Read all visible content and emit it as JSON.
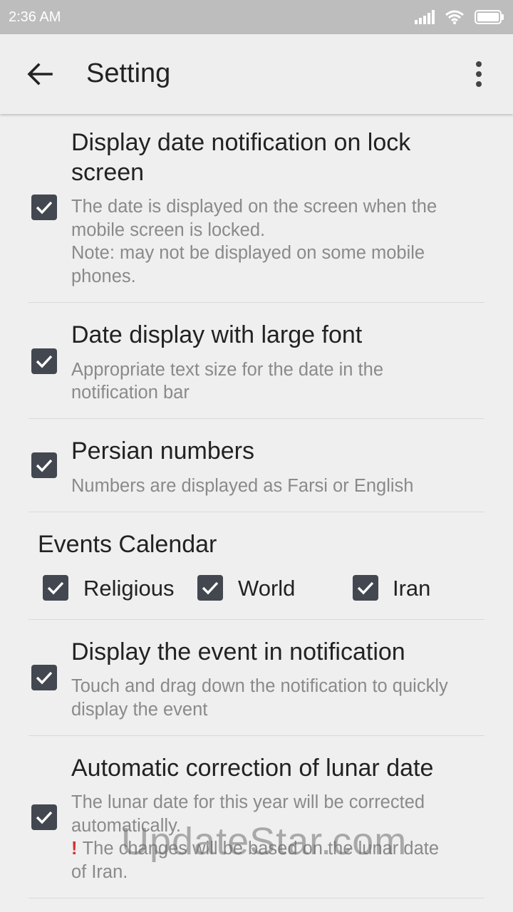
{
  "status_bar": {
    "time": "2:36 AM"
  },
  "app_bar": {
    "title": "Setting"
  },
  "settings": [
    {
      "title_lines": [
        "Display date notification on lock",
        "screen"
      ],
      "sub_lines": [
        "The date is displayed on the screen when the",
        "mobile screen is locked.",
        "Note: may not be displayed on some mobile",
        "phones."
      ],
      "checked": true
    },
    {
      "title_lines": [
        "Date display with large font"
      ],
      "sub_lines": [
        "Appropriate text size for the date in the",
        "notification bar"
      ],
      "checked": true
    },
    {
      "title_lines": [
        "Persian numbers"
      ],
      "sub_lines": [
        "Numbers are displayed as Farsi or English"
      ],
      "checked": true
    },
    {
      "title_lines": [
        "Display the event in notification"
      ],
      "sub_lines": [
        "Touch and drag down the notification to quickly",
        "display the event"
      ],
      "checked": true
    },
    {
      "title_lines": [
        "Automatic correction of lunar date"
      ],
      "sub_lines": [
        "The lunar date for this year will be corrected",
        "automatically.",
        "The changes will be based on the lunar date",
        "of Iran."
      ],
      "checked": true
    }
  ],
  "events_calendar": {
    "title": "Events Calendar",
    "options": [
      {
        "label": "Religious",
        "checked": true
      },
      {
        "label": "World",
        "checked": true
      },
      {
        "label": "Iran",
        "checked": true
      }
    ]
  },
  "warning_icon": "exclamation-icon",
  "watermark": "UpdateStar.com",
  "colors": {
    "checkbox": "#424750",
    "status_bar": "#bdbdbd",
    "background": "#efefef",
    "warning": "#d32f2f"
  }
}
